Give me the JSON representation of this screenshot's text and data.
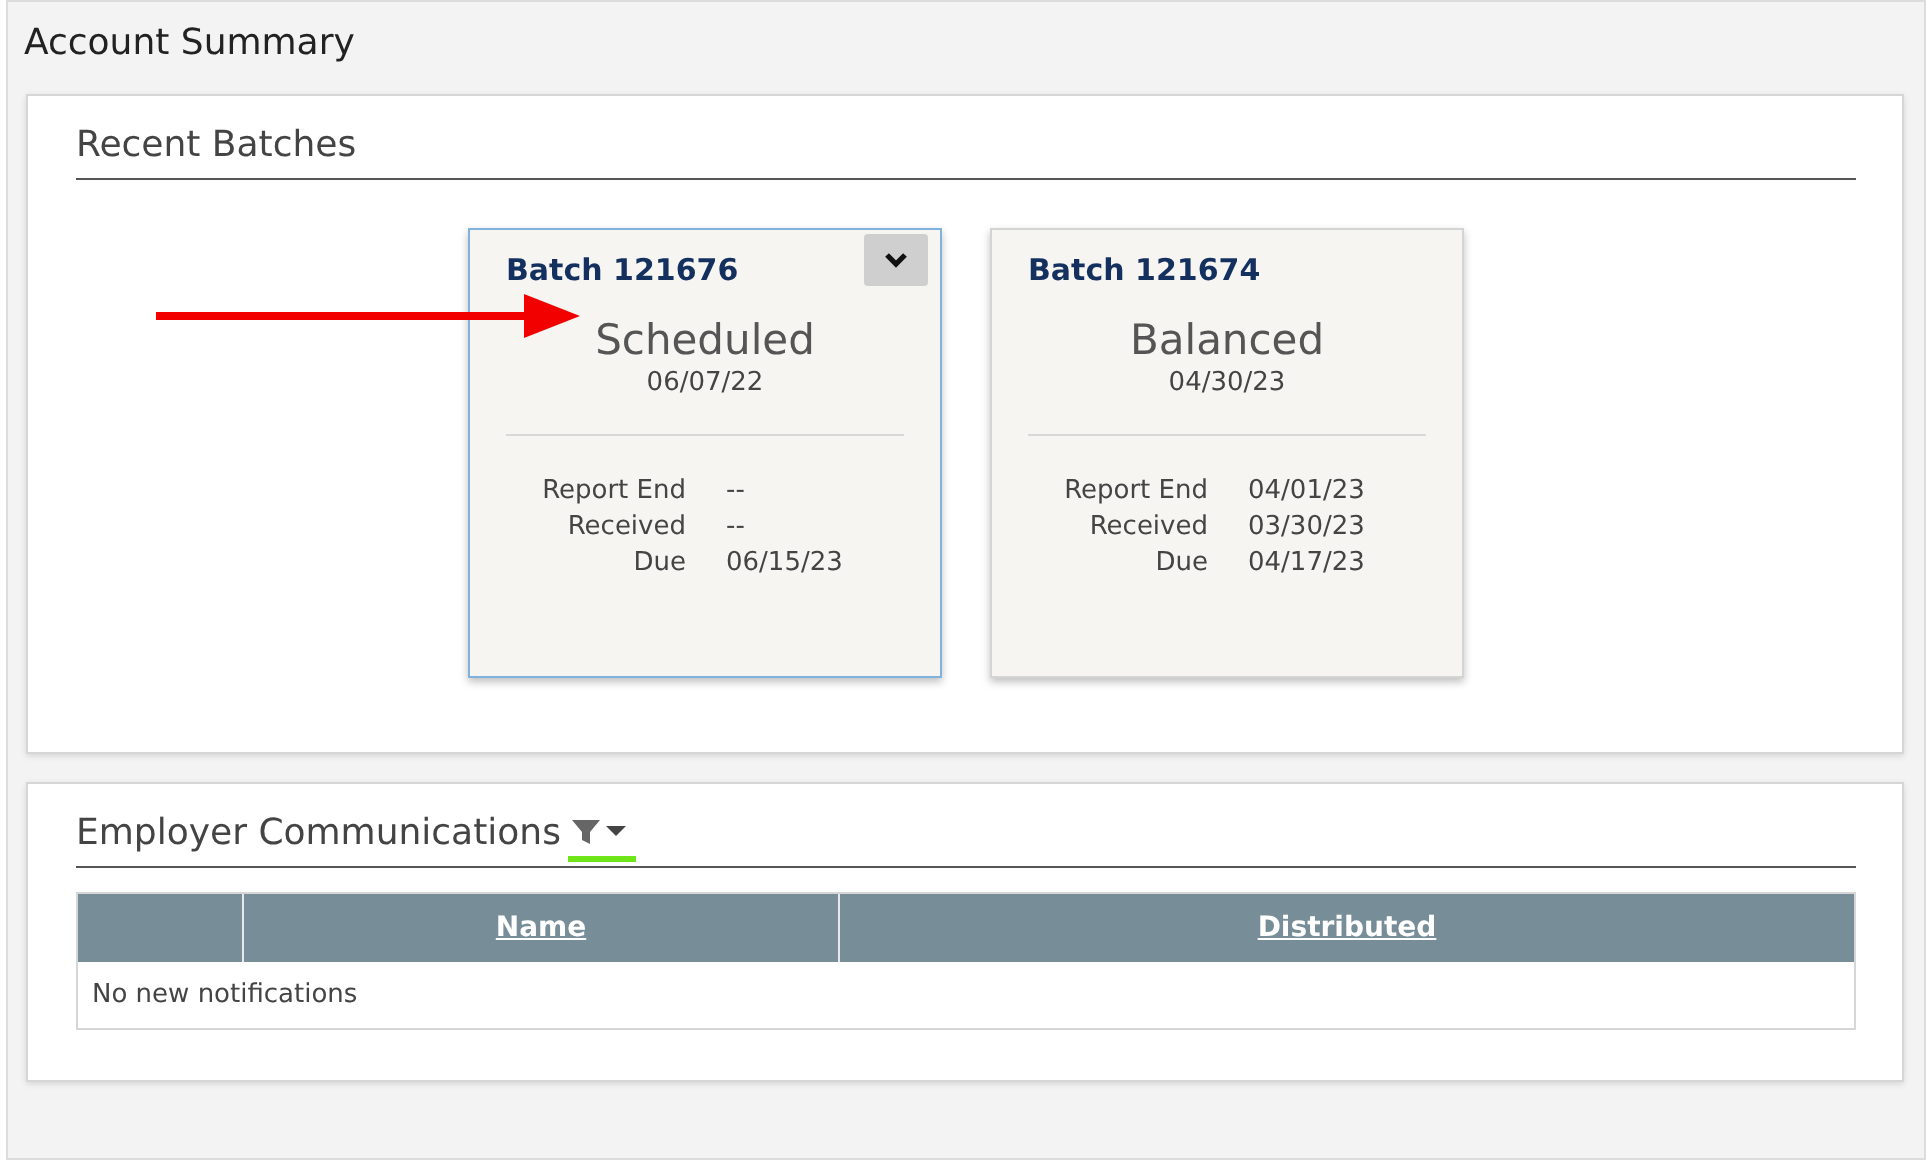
{
  "page_title": "Account Summary",
  "recent_batches": {
    "title": "Recent Batches",
    "cards": [
      {
        "title": "Batch 121676",
        "status": "Scheduled",
        "date": "06/07/22",
        "selected": true,
        "details": [
          {
            "label": "Report End",
            "value": "--"
          },
          {
            "label": "Received",
            "value": "--"
          },
          {
            "label": "Due",
            "value": "06/15/23"
          }
        ]
      },
      {
        "title": "Batch 121674",
        "status": "Balanced",
        "date": "04/30/23",
        "selected": false,
        "details": [
          {
            "label": "Report End",
            "value": "04/01/23"
          },
          {
            "label": "Received",
            "value": "03/30/23"
          },
          {
            "label": "Due",
            "value": "04/17/23"
          }
        ]
      }
    ]
  },
  "communications": {
    "title": "Employer Communications",
    "table": {
      "columns": [
        "Name",
        "Distributed"
      ],
      "empty_message": "No new notifications"
    }
  }
}
